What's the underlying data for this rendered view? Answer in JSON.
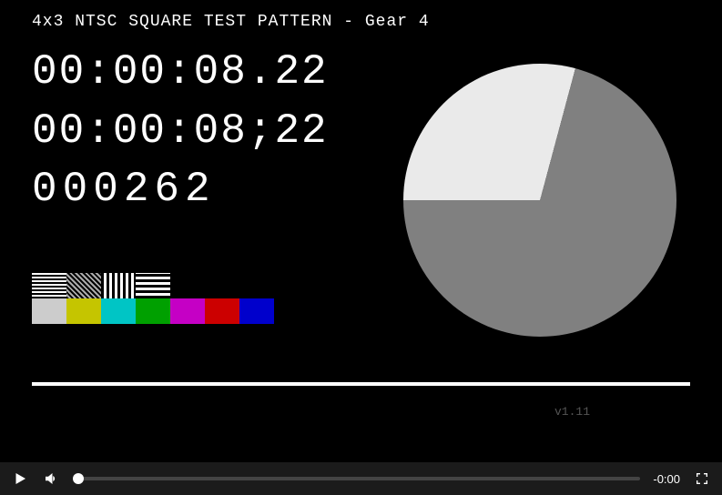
{
  "test_pattern": {
    "title": "4x3 NTSC SQUARE TEST PATTERN - Gear 4",
    "timecode_non_drop": "00:00:08.22",
    "timecode_drop": "00:00:08;22",
    "frame_counter": "000262",
    "pie_progress_deg": 105,
    "pie_bg": "#808080",
    "pie_fg": "#eaeaea",
    "version": "v1.11"
  },
  "color_bars": {
    "row1": [
      "stripes-h",
      "stripes-g",
      "stripes-v",
      "stripes-b"
    ],
    "row2": [
      "#cccccc",
      "#c5c500",
      "#00c5c5",
      "#00a000",
      "#c500c5",
      "#cc0000",
      "#0000cc"
    ]
  },
  "player": {
    "progress_percent": 0,
    "time_remaining": "-0:00"
  }
}
